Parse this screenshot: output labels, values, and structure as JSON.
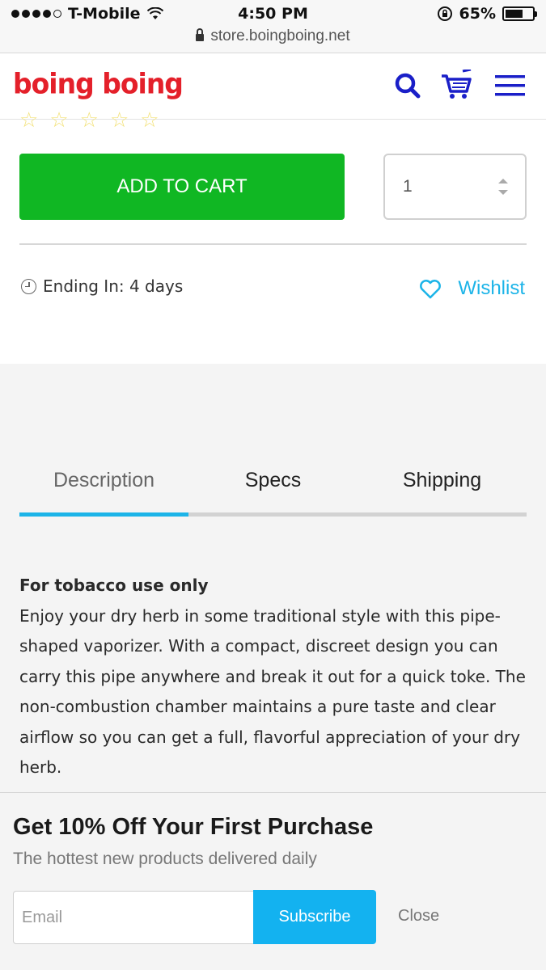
{
  "status_bar": {
    "carrier": "T-Mobile",
    "signal_bars": 4,
    "signal_max": 5,
    "time": "4:50 PM",
    "battery": "65%",
    "battery_level": 0.65,
    "url": "store.boingboing.net",
    "icons": [
      "wifi-icon",
      "rotation-lock-icon",
      "battery-icon",
      "lock-icon"
    ]
  },
  "header": {
    "logo": "boing boing",
    "icons": [
      "search-icon",
      "cart-icon",
      "hamburger-menu-icon"
    ],
    "accent_color": "#1a1fc8",
    "logo_color": "#e4202a"
  },
  "product": {
    "rating_stars": 5,
    "add_to_cart_label": "ADD TO CART",
    "add_to_cart_color": "#10b723",
    "quantity": "1",
    "ending_label": "Ending In: 4 days",
    "wishlist_label": "Wishlist",
    "wishlist_color": "#1cb4e8"
  },
  "tabs": [
    {
      "label": "Description",
      "active": true
    },
    {
      "label": "Specs",
      "active": false
    },
    {
      "label": "Shipping",
      "active": false
    }
  ],
  "description": {
    "title": "For tobacco use only",
    "body": "Enjoy your dry herb in some traditional style with this pipe-shaped vaporizer. With a compact, discreet design you can carry this pipe anywhere and break it out for a quick toke. The non-combustion chamber maintains a pure taste and clear airflow so you can get a full, flavorful appreciation of your dry herb."
  },
  "popup": {
    "title": "Get 10% Off Your First Purchase",
    "subtitle": "The hottest new products delivered daily",
    "email_placeholder": "Email",
    "subscribe_label": "Subscribe",
    "close_label": "Close",
    "subscribe_color": "#13b2f0"
  }
}
